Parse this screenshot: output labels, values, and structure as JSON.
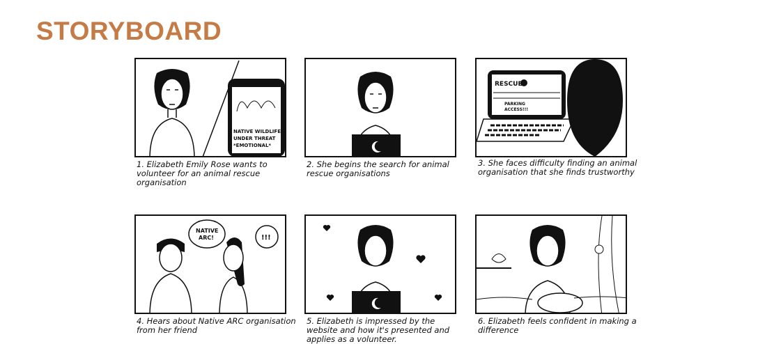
{
  "title": "STORYBOARD",
  "accent_color": "#c57b45",
  "panels": [
    {
      "caption": "1. Elizabeth Emily Rose wants to volunteer for an animal rescue organisation",
      "phone_text": [
        "NATIVE WILDLIFE",
        "UNDER THREAT",
        "*EMOTIONAL*"
      ]
    },
    {
      "caption": "2. She begins the search for animal rescue organisations"
    },
    {
      "caption": "3. She faces difficulty finding an animal organisation that she finds trustworthy",
      "screen_title": "RESCUE",
      "screen_text": [
        "PARKING",
        "ACCESS!!!"
      ]
    },
    {
      "caption": "4. Hears about Native ARC organisation from her friend",
      "bubble1": [
        "NATIVE",
        "ARC!"
      ],
      "bubble2": "!!!"
    },
    {
      "caption": "5. Elizabeth is impressed by the website and how it's presented and applies as a volunteer."
    },
    {
      "caption": "6. Elizabeth feels confident in making a difference"
    }
  ]
}
